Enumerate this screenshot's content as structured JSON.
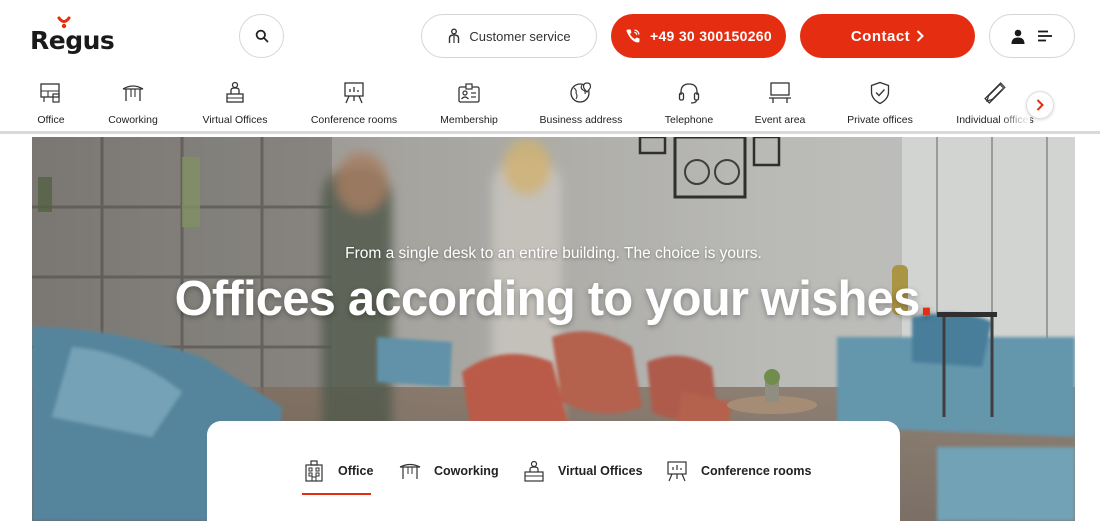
{
  "brand": {
    "name": "Regus"
  },
  "header": {
    "search_label": "",
    "customer_service_label": "Customer service",
    "phone_label": "+49 30 300150260",
    "contact_label": "Contact",
    "accent_color": "#e52d12"
  },
  "categories": [
    {
      "label": "Office",
      "icon": "office-desk-icon"
    },
    {
      "label": "Coworking",
      "icon": "coworking-table-icon"
    },
    {
      "label": "Virtual Offices",
      "icon": "virtual-office-icon"
    },
    {
      "label": "Conference rooms",
      "icon": "conference-board-icon"
    },
    {
      "label": "Membership",
      "icon": "membership-card-icon"
    },
    {
      "label": "Business address",
      "icon": "globe-pin-icon"
    },
    {
      "label": "Telephone",
      "icon": "headset-icon"
    },
    {
      "label": "Event area",
      "icon": "event-podium-icon"
    },
    {
      "label": "Private offices",
      "icon": "shield-icon"
    },
    {
      "label": "Individual offices",
      "icon": "ruler-pencil-icon"
    }
  ],
  "hero": {
    "subtitle": "From a single desk to an entire building. The choice is yours.",
    "title": "Offices according to your wishes",
    "title_dot": "."
  },
  "search_tabs": [
    {
      "label": "Office",
      "icon": "building-icon",
      "active": true
    },
    {
      "label": "Coworking",
      "icon": "coworking-table-icon",
      "active": false
    },
    {
      "label": "Virtual Offices",
      "icon": "virtual-office-icon",
      "active": false
    },
    {
      "label": "Conference rooms",
      "icon": "conference-board-icon",
      "active": false
    }
  ]
}
